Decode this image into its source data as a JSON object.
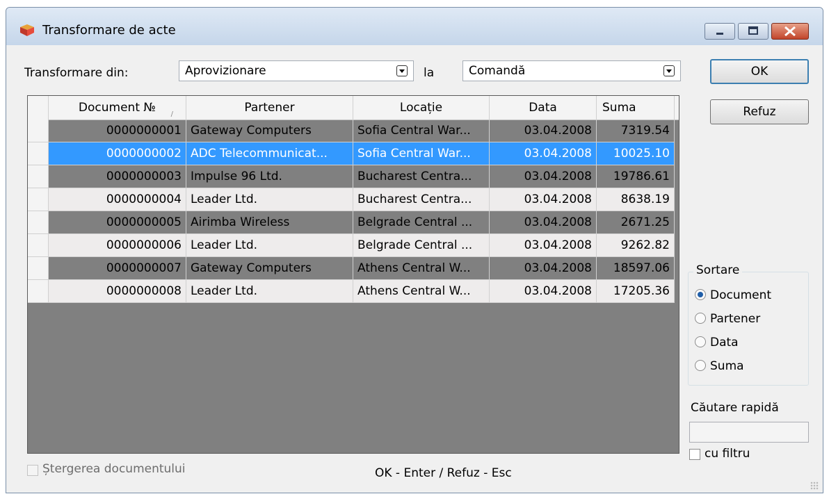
{
  "window": {
    "title": "Transformare de acte"
  },
  "header": {
    "from_label": "Transformare din:",
    "from_value": "Aprovizionare",
    "to_label": "la",
    "to_value": "Comandă"
  },
  "buttons": {
    "ok": "OK",
    "cancel": "Refuz"
  },
  "grid": {
    "columns": [
      "Document №",
      "Partener",
      "Locație",
      "Data",
      "Suma"
    ],
    "selected_index": 1,
    "rows": [
      [
        "0000000001",
        "Gateway Computers",
        "Sofia Central War...",
        "03.04.2008",
        "7319.54"
      ],
      [
        "0000000002",
        "ADC Telecommunicat...",
        "Sofia Central War...",
        "03.04.2008",
        "10025.10"
      ],
      [
        "0000000003",
        "Impulse 96 Ltd.",
        "Bucharest Centra...",
        "03.04.2008",
        "19786.61"
      ],
      [
        "0000000004",
        "Leader Ltd.",
        "Bucharest Centra...",
        "03.04.2008",
        "8638.19"
      ],
      [
        "0000000005",
        "Airimba Wireless",
        "Belgrade Central ...",
        "03.04.2008",
        "2671.25"
      ],
      [
        "0000000006",
        "Leader Ltd.",
        "Belgrade Central ...",
        "03.04.2008",
        "9262.82"
      ],
      [
        "0000000007",
        "Gateway Computers",
        "Athens Central W...",
        "03.04.2008",
        "18597.06"
      ],
      [
        "0000000008",
        "Leader Ltd.",
        "Athens Central W...",
        "03.04.2008",
        "17205.36"
      ]
    ]
  },
  "sort": {
    "label": "Sortare",
    "options": [
      "Document",
      "Partener",
      "Data",
      "Suma"
    ],
    "selected": "Document"
  },
  "search": {
    "label": "Căutare rapidă",
    "value": "",
    "filter_label": "cu filtru"
  },
  "footer": {
    "delete_label": "Ștergerea documentului",
    "hint": "OK - Enter / Refuz - Esc"
  },
  "colors": {
    "selection": "#3399ff",
    "grid_empty": "#808080",
    "title_gradient_top": "#dfe9f5"
  }
}
